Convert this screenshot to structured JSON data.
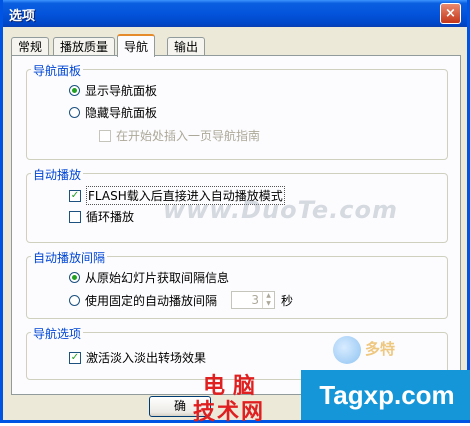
{
  "window": {
    "title": "选项",
    "close_glyph": "×"
  },
  "tabs": [
    {
      "label": "常规"
    },
    {
      "label": "播放质量"
    },
    {
      "label": "导航"
    },
    {
      "label": "输出"
    }
  ],
  "groups": {
    "nav_panel": {
      "legend": "导航面板",
      "show_label": "显示导航面板",
      "hide_label": "隐藏导航面板",
      "insert_label": "在开始处插入一页导航指南"
    },
    "autoplay": {
      "legend": "自动播放",
      "flash_label": "FLASH载入后直接进入自动播放模式",
      "loop_label": "循环播放"
    },
    "interval": {
      "legend": "自动播放间隔",
      "original_label": "从原始幻灯片获取间隔信息",
      "fixed_label": "使用固定的自动播放间隔",
      "fixed_value": "3",
      "unit": "秒"
    },
    "nav_options": {
      "legend": "导航选项",
      "fade_label": "激活淡入淡出转场效果"
    }
  },
  "ok_button": {
    "label": "确"
  },
  "watermarks": {
    "duote": "www.DuoTe.com",
    "duote_logo": "多特",
    "cn_line1": "电脑",
    "cn_line2": "技术网",
    "site": "Tagxp.com"
  },
  "state": {
    "nav_show": true,
    "nav_hide": false,
    "insert_guide": false,
    "flash_autoplay": true,
    "loop": false,
    "interval_original": true,
    "interval_fixed": false,
    "fade": true
  },
  "colors": {
    "title_bar": "#0454db",
    "legend_text": "#0046d5",
    "check_mark": "#21a121",
    "tab_highlight": "#e68b2c"
  }
}
